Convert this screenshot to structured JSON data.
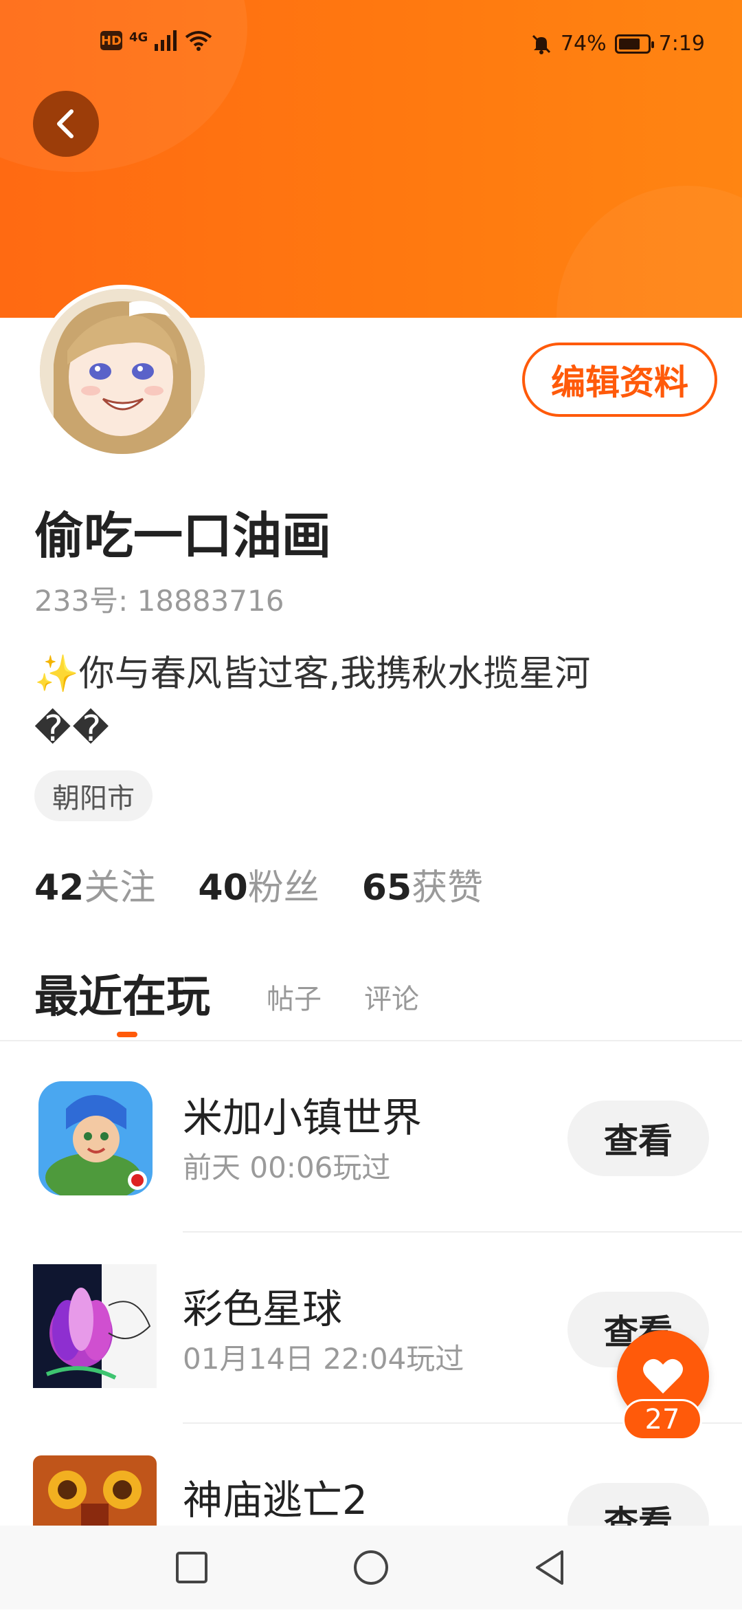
{
  "status_bar": {
    "hd": "HD",
    "network": "4G",
    "battery_percent": "74%",
    "battery_level": 0.74,
    "time": "7:19"
  },
  "profile": {
    "nickname": "偷吃一口油画",
    "uid": "233号: 18883716",
    "bio_line1": "✨你与春风皆过客,我携秋水揽星河",
    "bio_line2": "��",
    "location": "朝阳市",
    "edit_label": "编辑资料"
  },
  "stats": [
    {
      "value": "42",
      "label": "关注"
    },
    {
      "value": "40",
      "label": "粉丝"
    },
    {
      "value": "65",
      "label": "获赞"
    }
  ],
  "tabs": [
    {
      "label": "最近在玩",
      "active": true
    },
    {
      "label": "帖子",
      "active": false
    },
    {
      "label": "评论",
      "active": false
    }
  ],
  "games": [
    {
      "title": "米加小镇世界",
      "played": "前天 00:06玩过",
      "button": "查看"
    },
    {
      "title": "彩色星球",
      "played": "01月14日 22:04玩过",
      "button": "查看"
    },
    {
      "title": "神庙逃亡2",
      "played": "",
      "button": "查看"
    }
  ],
  "likes": {
    "count": "27"
  },
  "colors": {
    "accent": "#ff5a0a",
    "header": "#ff7a10",
    "back_button": "#9c3d09"
  }
}
